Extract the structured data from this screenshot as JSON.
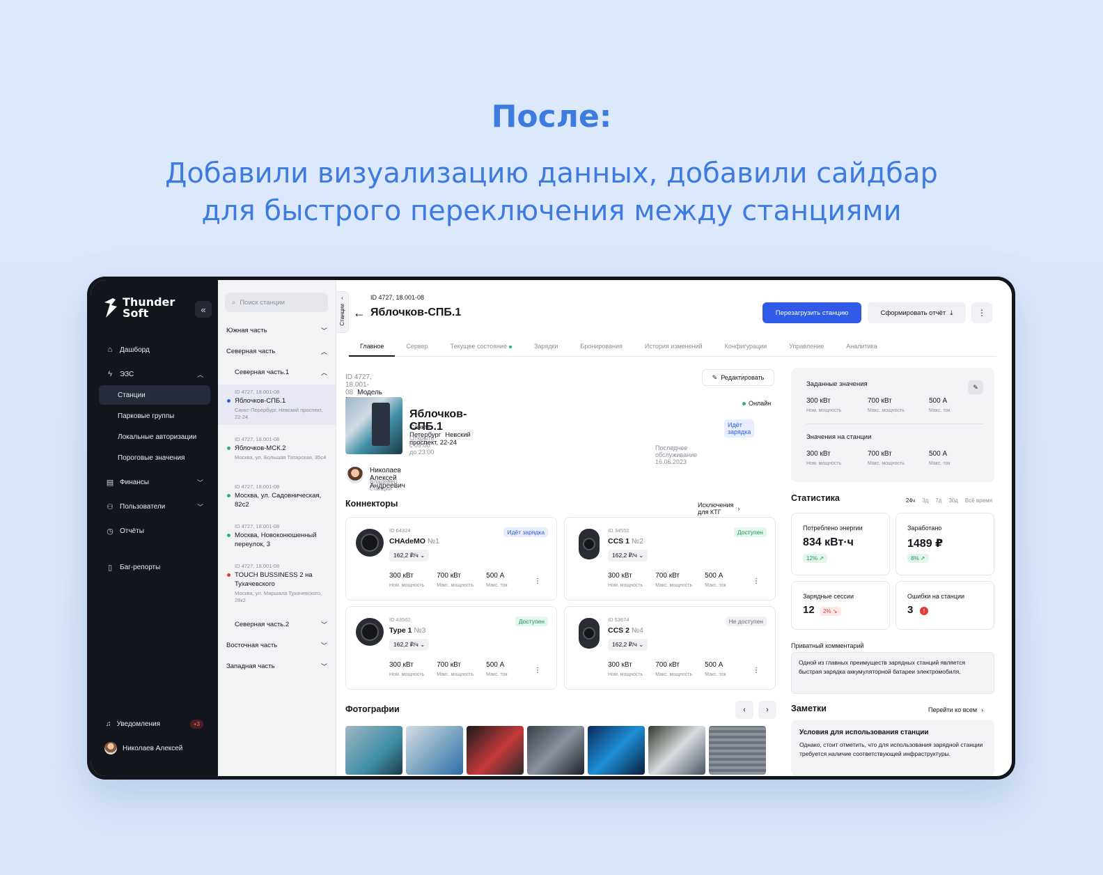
{
  "hero": {
    "title": "После:",
    "sub_line1": "Добавили визуализацию данных, добавили сайдбар",
    "sub_line2": "для быстрого переключения между станциями"
  },
  "nav": {
    "logo_line1": "Thunder",
    "logo_line2": "Soft",
    "collapse": "«",
    "items": [
      {
        "label": "Дашборд"
      },
      {
        "label": "ЭЗС"
      },
      {
        "label": "Финансы"
      },
      {
        "label": "Пользователи"
      },
      {
        "label": "Отчёты"
      },
      {
        "label": "Баг-репорты"
      }
    ],
    "sub": [
      "Станции",
      "Парковые группы",
      "Локальные авторизации",
      "Пороговые значения"
    ],
    "notifications": "Уведомления",
    "notif_count": "+3",
    "user": "Николаев Алексей"
  },
  "stations": {
    "search_placeholder": "Поиск станции",
    "groups": [
      "Южная часть",
      "Северная часть",
      "Северная часть.1",
      "Северная часть.2",
      "Восточная часть",
      "Западная часть"
    ],
    "vtab": "Станции",
    "list": [
      {
        "id": "ID 4727, 18.001-08",
        "name": "Яблочков-СПБ.1",
        "addr": "Санкт-Перербург, Невский проспект, 22-24",
        "color": "#2f5be8"
      },
      {
        "id": "ID 4727, 18.001-08",
        "name": "Яблочков-МСК.2",
        "addr": "Москва, ул. Большая Татарская, 35с4",
        "color": "#1fb86a"
      },
      {
        "id": "ID 4727, 18.001-08",
        "name": "Москва, ул. Садовническая, 82с2",
        "addr": "",
        "color": "#1fb86a"
      },
      {
        "id": "ID 4727, 18.001-08",
        "name": "Москва, Новоконюшенный переулок, 3",
        "addr": "",
        "color": "#1fb86a"
      },
      {
        "id": "ID 4727, 18.001-08",
        "name": "TOUCH BUSSINESS 2 на Тухачевского",
        "addr": "Москва, ул. Маршала Тухачевского, 28к2",
        "color": "#e03c3c"
      }
    ]
  },
  "header": {
    "id": "ID 4727, 18.001-08",
    "title": "Яблочков-СПБ.1",
    "reload": "Перезагрузить станцию",
    "report": "Сформировать отчёт",
    "more": "⋮"
  },
  "tabs": [
    "Главное",
    "Сервер",
    "Текущее состояние",
    "Зарядки",
    "Бронирования",
    "История изменений",
    "Конфигурации",
    "Управление",
    "Аналитика"
  ],
  "station": {
    "meta_id": "ID 4727, 18.001-08",
    "model": "Модель МУБЗС",
    "edit": "Редактировать",
    "name": "Яблочков-СПБ.1",
    "city": "Санкт-Петербург",
    "street": "Невский проспект, 22-24",
    "open": "Открыто с 09:00 до 23:00",
    "online": "Онлайн",
    "charging": "Идёт зарядка",
    "last_service": "Последнее обслуживание 16.06.2023",
    "owner": "Николаев Алексей Андреевич",
    "owner_role": "Владелец станции"
  },
  "connectors": {
    "title": "Коннекторы",
    "link": "Исключения для КТГ",
    "lbl_power": "Ном. мощность",
    "lbl_max": "Макс. мощность",
    "lbl_current": "Макс. ток",
    "items": [
      {
        "id": "ID 64324",
        "name": "CHAdeMO",
        "num": "№1",
        "price": "162,2 ₽/ч",
        "badge": "Идёт зарядка",
        "p": "300 кВт",
        "m": "700 кВт",
        "c": "500 А"
      },
      {
        "id": "ID 34552",
        "name": "CCS 1",
        "num": "№2",
        "price": "162,2 ₽/ч",
        "badge": "Доступен",
        "p": "300 кВт",
        "m": "700 кВт",
        "c": "500 А"
      },
      {
        "id": "ID 43562",
        "name": "Type 1",
        "num": "№3",
        "price": "162,2 ₽/ч",
        "badge": "Доступен",
        "p": "300 кВт",
        "m": "700 кВт",
        "c": "500 А"
      },
      {
        "id": "ID 53674",
        "name": "CCS 2",
        "num": "№4",
        "price": "162,2 ₽/ч",
        "badge": "Не доступен",
        "p": "300 кВт",
        "m": "700 кВт",
        "c": "500 А"
      }
    ]
  },
  "photos": {
    "title": "Фотографии"
  },
  "preset": {
    "title": "Заданные значения",
    "title2": "Значения на станции",
    "v1": "300 кВт",
    "v2": "700 кВт",
    "v3": "500 А",
    "l1": "Ном. мощность",
    "l2": "Макс. мощность",
    "l3": "Макс. ток"
  },
  "stats": {
    "title": "Статистика",
    "periods": [
      "24ч",
      "3д",
      "7д",
      "30д",
      "Всё время"
    ],
    "energy_lbl": "Потреблено энергии",
    "energy_val": "834 кВт·ч",
    "energy_pill": "12% ↗",
    "earned_lbl": "Заработано",
    "earned_val": "1489 ₽",
    "earned_pill": "8% ↗",
    "sess_lbl": "Зарядные сессии",
    "sess_val": "12",
    "sess_pill": "2% ↘",
    "err_lbl": "Ошибки на станции",
    "err_val": "3"
  },
  "comment": {
    "title": "Приватный комментарий",
    "text": "Одной из главных преимуществ зарядных станций является быстрая зарядка аккумуляторной батареи электромобиля."
  },
  "notes": {
    "title": "Заметки",
    "link": "Перейти ко всем",
    "note_title": "Условия для использования станции",
    "note_text": "Однако, стоит отметить, что для использования зарядной станции требуется наличие соответствующей инфраструктуры."
  }
}
